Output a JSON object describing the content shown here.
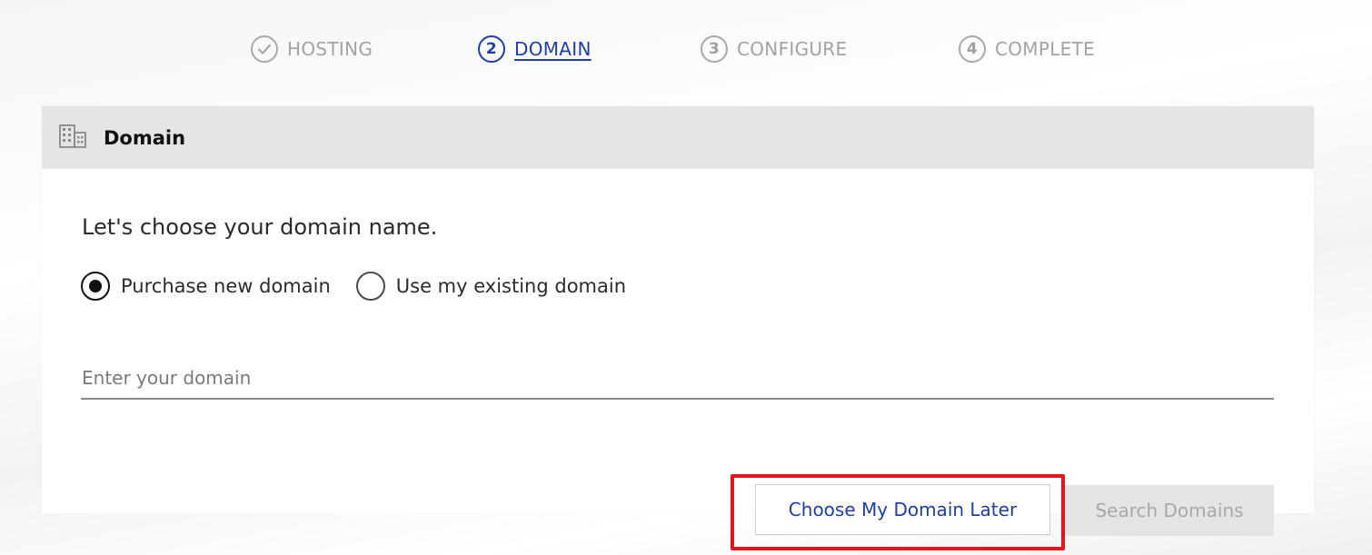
{
  "steps": [
    {
      "label": "HOSTING",
      "marker": "✓",
      "state": "done"
    },
    {
      "label": "DOMAIN",
      "marker": "2",
      "state": "active"
    },
    {
      "label": "CONFIGURE",
      "marker": "3",
      "state": "pending"
    },
    {
      "label": "COMPLETE",
      "marker": "4",
      "state": "pending"
    }
  ],
  "card": {
    "title": "Domain",
    "icon": "building-icon",
    "question": "Let's choose your domain name.",
    "options": [
      {
        "label": "Purchase new domain",
        "checked": true
      },
      {
        "label": "Use my existing domain",
        "checked": false
      }
    ],
    "domain_input": {
      "placeholder": "Enter your domain",
      "value": ""
    },
    "choose_later_label": "Choose My Domain Later",
    "search_label": "Search Domains"
  },
  "colors": {
    "accent": "#1f3fa6",
    "highlight": "#e8141c",
    "header_bg": "#e5e5e5",
    "disabled_button_bg": "#e4e4e4"
  }
}
